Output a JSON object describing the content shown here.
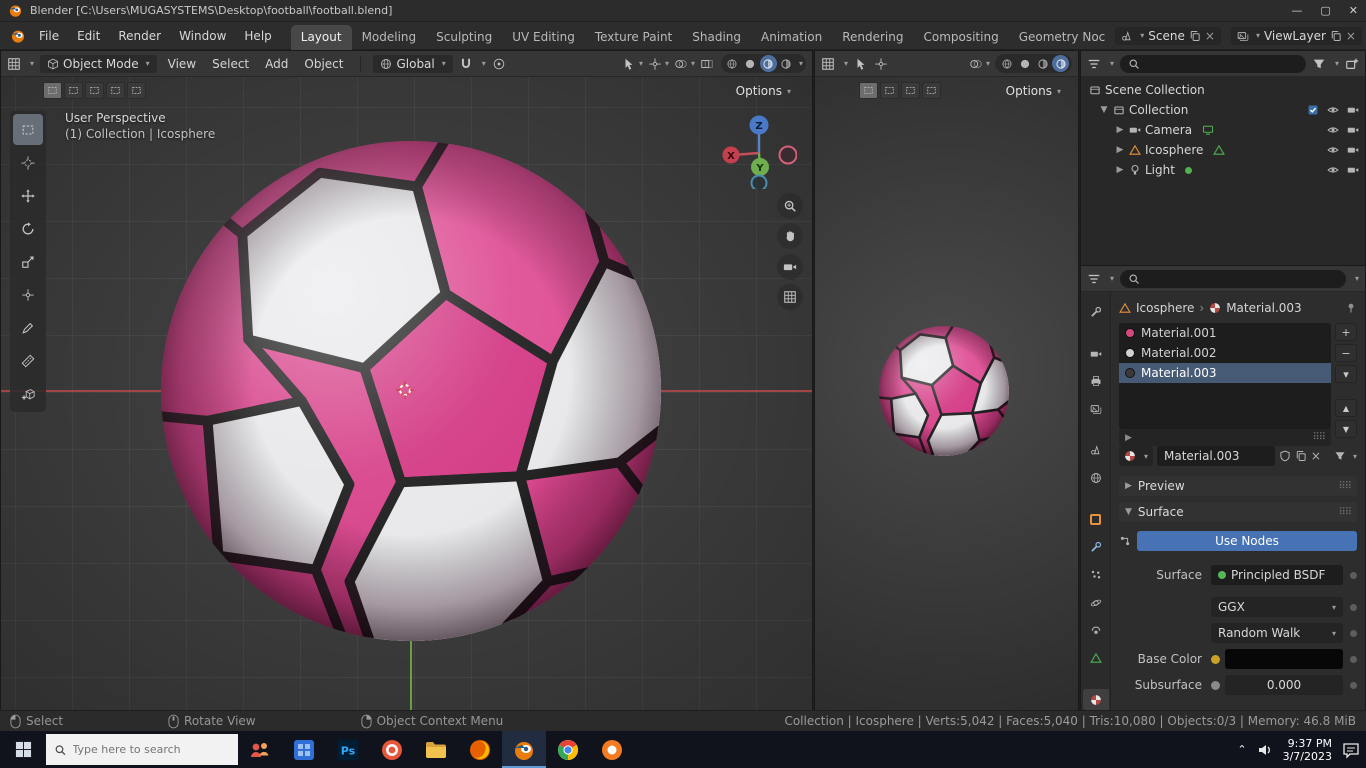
{
  "window": {
    "title": "Blender [C:\\Users\\MUGASYSTEMS\\Desktop\\football\\football.blend]"
  },
  "topbar": {
    "menus": [
      "File",
      "Edit",
      "Render",
      "Window",
      "Help"
    ],
    "workspaces": [
      {
        "label": "Layout",
        "active": true
      },
      {
        "label": "Modeling"
      },
      {
        "label": "Sculpting"
      },
      {
        "label": "UV Editing"
      },
      {
        "label": "Texture Paint"
      },
      {
        "label": "Shading"
      },
      {
        "label": "Animation"
      },
      {
        "label": "Rendering"
      },
      {
        "label": "Compositing"
      },
      {
        "label": "Geometry Noc"
      }
    ],
    "scene_label": "Scene",
    "view_layer_label": "ViewLayer"
  },
  "vpL": {
    "mode": "Object Mode",
    "menus": [
      "View",
      "Select",
      "Add",
      "Object"
    ],
    "orientation": "Global",
    "options": "Options",
    "overlay": {
      "perspective": "User Perspective",
      "context": "(1) Collection | Icosphere"
    },
    "gizmo": {
      "z": "Z",
      "y": "Y",
      "x": "X"
    }
  },
  "vpM": {
    "options": "Options"
  },
  "outliner": {
    "rows": [
      {
        "label": "Scene Collection"
      },
      {
        "label": "Collection"
      },
      {
        "label": "Camera"
      },
      {
        "label": "Icosphere"
      },
      {
        "label": "Light"
      }
    ]
  },
  "props": {
    "breadcrumb": {
      "object": "Icosphere",
      "material": "Material.003"
    },
    "slots": [
      {
        "name": "Material.001",
        "color": "#d6477e"
      },
      {
        "name": "Material.002",
        "color": "#d0d0d0"
      },
      {
        "name": "Material.003",
        "color": "#3a3a3a"
      }
    ],
    "name_field": "Material.003",
    "preview": "Preview",
    "surface_section": "Surface",
    "use_nodes": "Use Nodes",
    "surface_label": "Surface",
    "surface_value": "Principled BSDF",
    "distribution": "GGX",
    "sss_method": "Random Walk",
    "base_color": "Base Color",
    "subsurface": "Subsurface",
    "subsurface_value": "0.000"
  },
  "status": {
    "select": "Select",
    "rotate": "Rotate View",
    "context_menu": "Object Context Menu",
    "stats": "Collection | Icosphere | Verts:5,042 | Faces:5,040 | Tris:10,080 | Objects:0/3 | Memory: 46.8 MiB"
  },
  "taskbar": {
    "search": "Type here to search",
    "time": "9:37 PM",
    "date": "3/7/2023"
  }
}
